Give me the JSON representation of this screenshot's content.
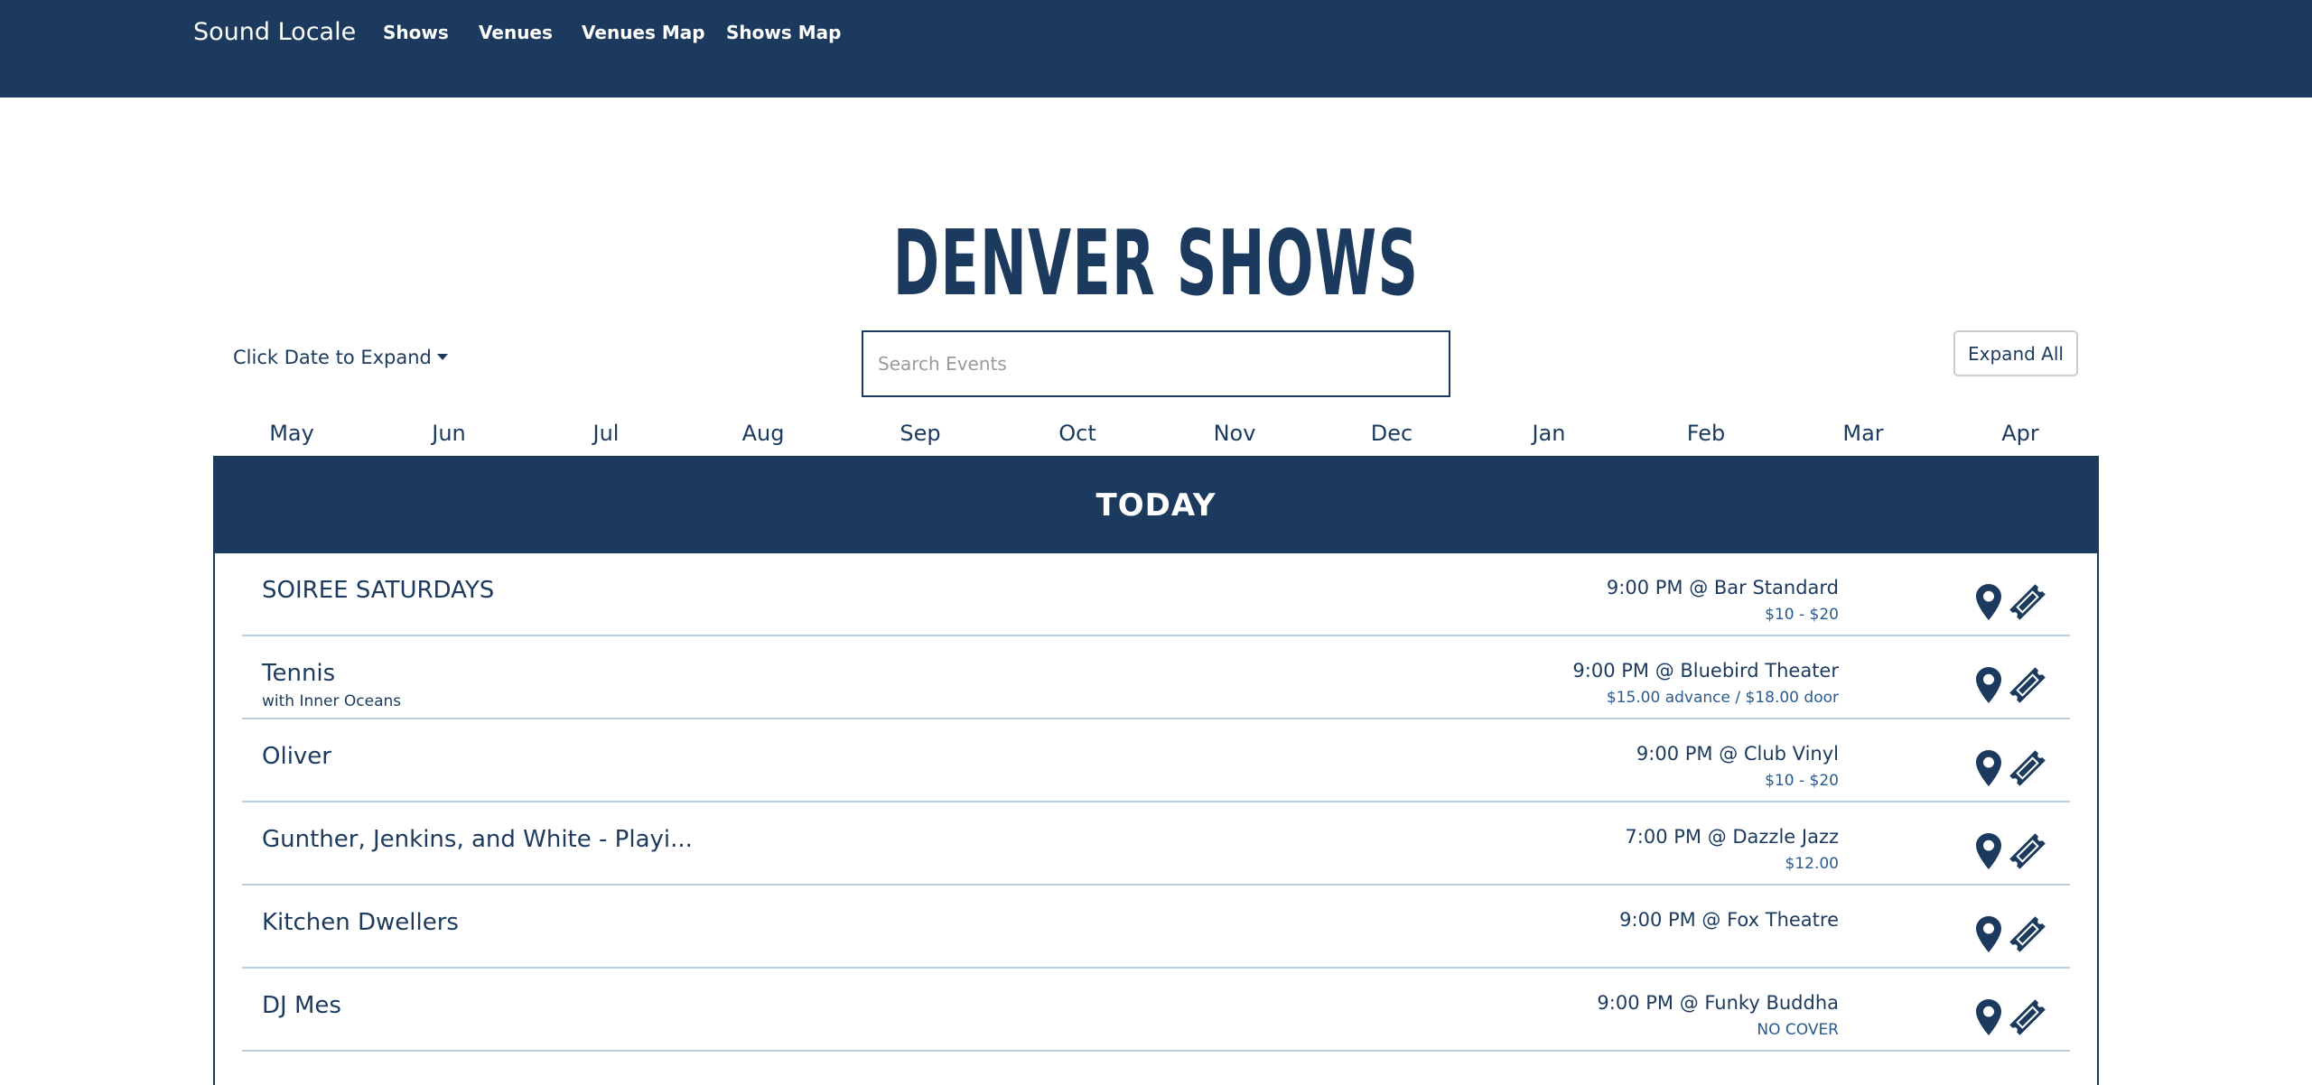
{
  "navbar": {
    "brand": "Sound Locale",
    "links": [
      "Shows",
      "Venues",
      "Venues Map",
      "Shows Map"
    ]
  },
  "page_title": "DENVER SHOWS",
  "controls": {
    "expand_dropdown": "Click Date to Expand",
    "search_placeholder": "Search Events",
    "expand_all": "Expand All"
  },
  "months": [
    "May",
    "Jun",
    "Jul",
    "Aug",
    "Sep",
    "Oct",
    "Nov",
    "Dec",
    "Jan",
    "Feb",
    "Mar",
    "Apr"
  ],
  "today_label": "TODAY",
  "events": [
    {
      "name": "SOIREE SATURDAYS",
      "support": "",
      "time_venue": "9:00 PM @ Bar Standard",
      "price": "$10 - $20"
    },
    {
      "name": "Tennis",
      "support": "with Inner Oceans",
      "time_venue": "9:00 PM @ Bluebird Theater",
      "price": "$15.00 advance / $18.00 door"
    },
    {
      "name": "Oliver",
      "support": "",
      "time_venue": "9:00 PM @ Club Vinyl",
      "price": "$10 - $20"
    },
    {
      "name": "Gunther, Jenkins, and White - Playi...",
      "support": "",
      "time_venue": "7:00 PM @ Dazzle Jazz",
      "price": "$12.00"
    },
    {
      "name": "Kitchen Dwellers",
      "support": "",
      "time_venue": "9:00 PM @ Fox Theatre",
      "price": ""
    },
    {
      "name": "DJ Mes",
      "support": "",
      "time_venue": "9:00 PM @ Funky Buddha",
      "price": "NO COVER"
    }
  ],
  "colors": {
    "primary": "#1b3a5e",
    "divider": "#b8cfe3",
    "price": "#2a5a8e"
  },
  "icons": {
    "venue": "map-pin-icon",
    "tickets": "ticket-icon"
  }
}
